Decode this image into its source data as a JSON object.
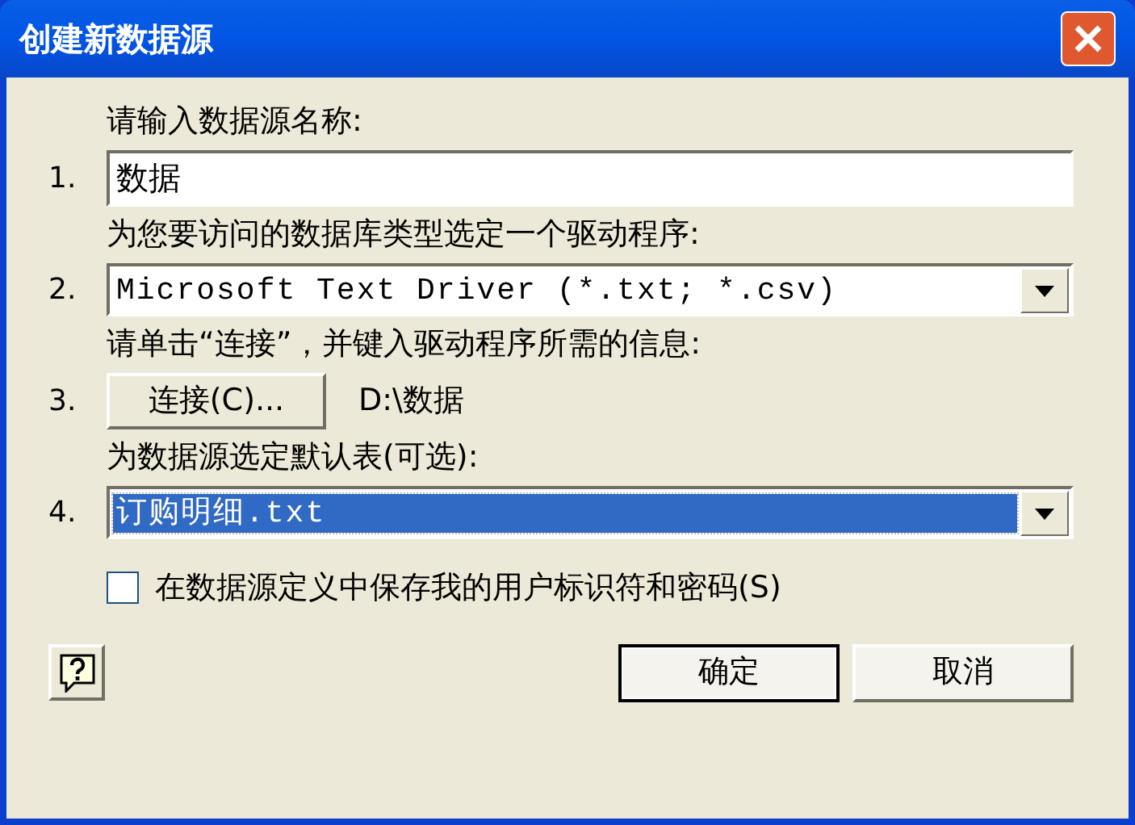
{
  "window": {
    "title": "创建新数据源"
  },
  "steps": [
    {
      "number": "1.",
      "label": "请输入数据源名称:",
      "kind": "text",
      "value": "数据"
    },
    {
      "number": "2.",
      "label": "为您要访问的数据库类型选定一个驱动程序:",
      "kind": "dropdown",
      "value": "Microsoft Text Driver (*.txt; *.csv)",
      "focused": false
    },
    {
      "number": "3.",
      "label": "请单击“连接”，并键入驱动程序所需的信息:",
      "kind": "button",
      "button": "连接(C)...",
      "path": "D:\\数据"
    },
    {
      "number": "4.",
      "label": "为数据源选定默认表(可选):",
      "kind": "dropdown",
      "value": "订购明细.txt",
      "focused": true
    }
  ],
  "save_credentials": {
    "label": "在数据源定义中保存我的用户标识符和密码(S)",
    "checked": false
  },
  "buttons": [
    {
      "label": "确定",
      "default": true
    },
    {
      "label": "取消",
      "default": false
    }
  ]
}
